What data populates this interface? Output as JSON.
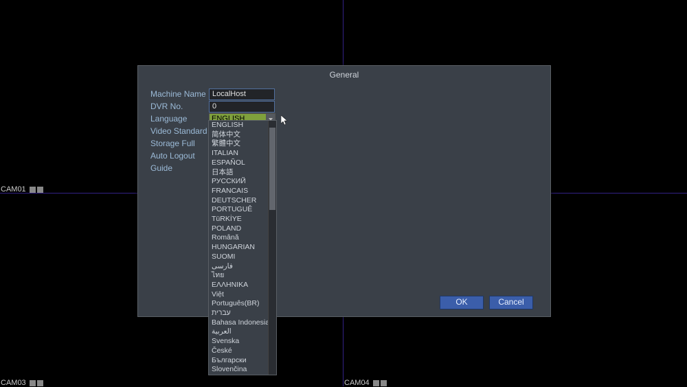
{
  "dialog": {
    "title": "General",
    "labels": {
      "machine_name": "Machine Name",
      "dvr_no": "DVR No.",
      "language": "Language",
      "video_standard": "Video Standard",
      "storage_full": "Storage Full",
      "auto_logout": "Auto Logout",
      "guide": "Guide"
    },
    "values": {
      "machine_name": "LocalHost",
      "dvr_no": "0",
      "language_selected": "ENGLISH"
    },
    "buttons": {
      "ok": "OK",
      "cancel": "Cancel"
    }
  },
  "language_options": [
    "ENGLISH",
    "简体中文",
    "繁體中文",
    "ITALIAN",
    "ESPAÑOL",
    "日本語",
    "РУССКИЙ",
    "FRANCAIS",
    "DEUTSCHER",
    "PORTUGUÊ",
    "TüRKİYE",
    "POLAND",
    "Română",
    "HUNGARIAN",
    "SUOMI",
    "فارسی",
    "ไทย",
    "ΕΛΛΗΝΙΚΑ",
    "Việt",
    "Português(BR)",
    "עברית",
    "Bahasa Indonesia",
    "العربية",
    "Svenska",
    "České",
    "Български",
    "Slovenčina"
  ],
  "cams": {
    "c1": "CAM01",
    "c3": "CAM03",
    "c4": "CAM04"
  }
}
